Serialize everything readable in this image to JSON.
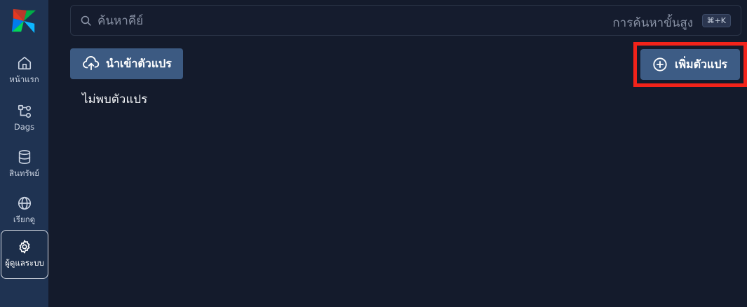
{
  "sidebar": {
    "items": [
      {
        "label": "หน้าแรก",
        "icon": "home-icon"
      },
      {
        "label": "Dags",
        "icon": "dag-icon"
      },
      {
        "label": "สินทรัพย์",
        "icon": "database-icon"
      },
      {
        "label": "เรียกดู",
        "icon": "globe-icon"
      },
      {
        "label": "ผู้ดูแลระบบ",
        "icon": "gear-icon",
        "active": true
      }
    ]
  },
  "search": {
    "placeholder": "ค้นหาคีย์",
    "advanced_label": "การค้นหาขั้นสูง",
    "shortcut": "⌘+K"
  },
  "toolbar": {
    "import_label": "นำเข้าตัวแปร",
    "add_label": "เพิ่มตัวแปร"
  },
  "main": {
    "empty_message": "ไม่พบตัวแปร"
  },
  "colors": {
    "background": "#141b2c",
    "sidebar": "#1f3352",
    "button": "#3c5a82",
    "highlight": "#f2231a"
  }
}
